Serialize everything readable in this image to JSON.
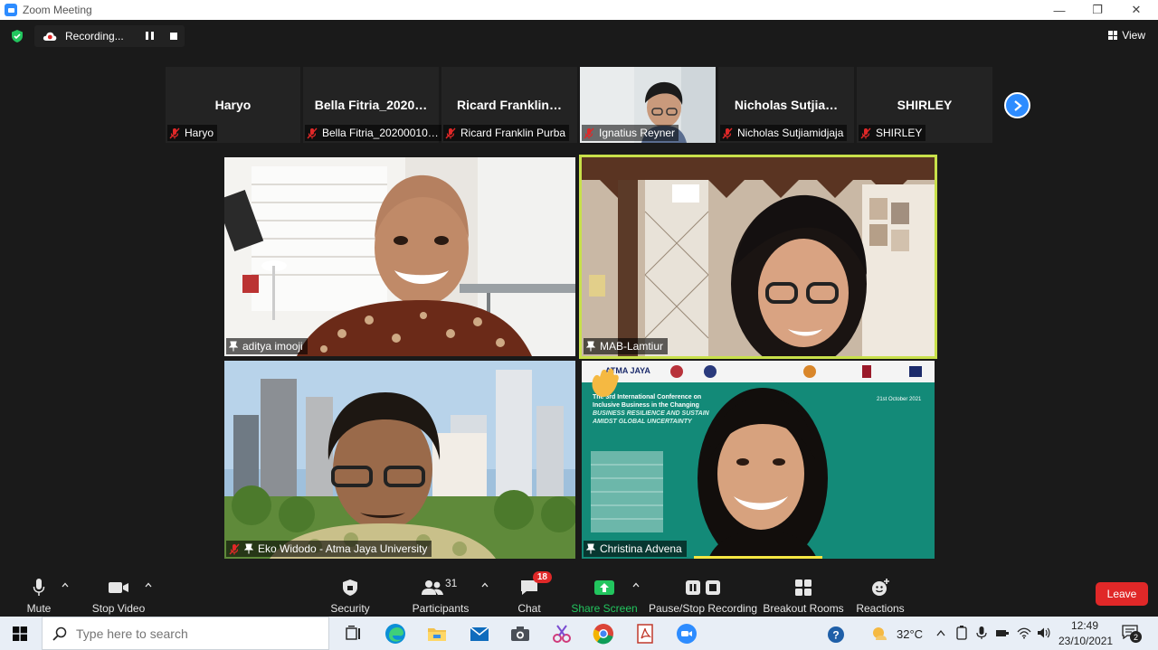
{
  "window": {
    "title": "Zoom Meeting",
    "minimize": "—",
    "restore": "❐",
    "close": "✕"
  },
  "recording": {
    "label": "Recording..."
  },
  "view": {
    "label": "View"
  },
  "strip": [
    {
      "display": "Haryo",
      "name": "Haryo"
    },
    {
      "display": "Bella Fitria_2020…",
      "name": "Bella Fitria_20200010…"
    },
    {
      "display": "Ricard  Franklin…",
      "name": "Ricard Franklin Purba"
    },
    {
      "display": "",
      "name": "Ignatius Reyner"
    },
    {
      "display": "Nicholas  Sutjia…",
      "name": "Nicholas Sutjiamidjaja"
    },
    {
      "display": "SHIRLEY",
      "name": "SHIRLEY"
    }
  ],
  "videos": [
    {
      "name": "aditya imooji"
    },
    {
      "name": "MAB-Lamtiur"
    },
    {
      "name": "Eko Widodo - Atma Jaya University"
    },
    {
      "name": "Christina Advena"
    }
  ],
  "slide": {
    "logo": "ATMA JAYA",
    "line1": "The 3rd International Conference on",
    "line2": "Inclusive Business in the Changing",
    "line3": "BUSINESS RESILIENCE AND SUSTAIN",
    "line4": "AMIDST GLOBAL UNCERTAINTY",
    "date": "21st October 2021"
  },
  "toolbar": {
    "mute": "Mute",
    "stop_video": "Stop Video",
    "security": "Security",
    "participants": "Participants",
    "participants_count": "31",
    "chat": "Chat",
    "chat_badge": "18",
    "share_screen": "Share Screen",
    "pause_stop_recording": "Pause/Stop Recording",
    "breakout_rooms": "Breakout Rooms",
    "reactions": "Reactions",
    "leave": "Leave"
  },
  "taskbar": {
    "search_placeholder": "Type here to search",
    "temperature": "32°C",
    "time": "12:49",
    "date": "23/10/2021",
    "notifications": "2"
  },
  "colors": {
    "accent": "#2d8cff",
    "active_speaker": "#c8e04a",
    "share": "#22c55e",
    "leave": "#e02828"
  }
}
